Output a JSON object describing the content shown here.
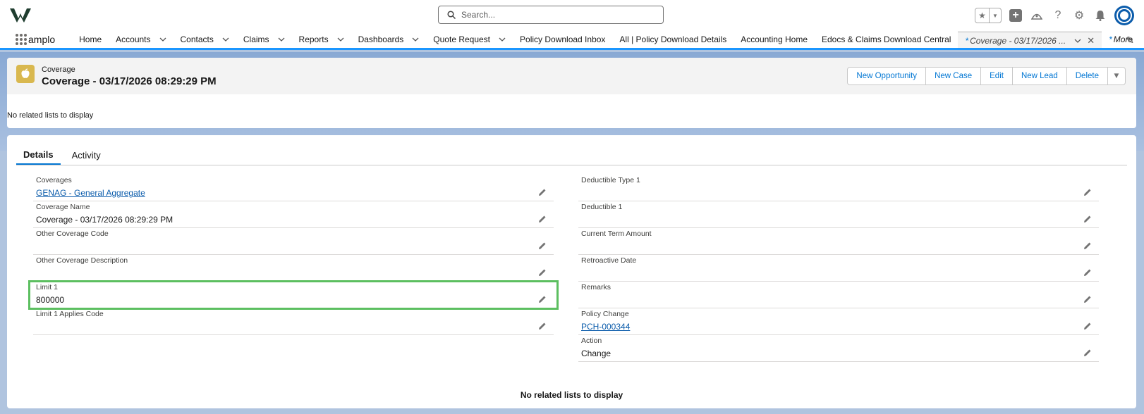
{
  "header": {
    "search_placeholder": "Search...",
    "icons": [
      "favorites-star-icon",
      "add-icon",
      "trailhead-icon",
      "help-icon",
      "setup-gear-icon",
      "notifications-bell-icon",
      "avatar"
    ]
  },
  "nav": {
    "app_name": "amplo",
    "items": [
      {
        "label": "Home",
        "dropdown": false
      },
      {
        "label": "Accounts",
        "dropdown": true
      },
      {
        "label": "Contacts",
        "dropdown": true
      },
      {
        "label": "Claims",
        "dropdown": true
      },
      {
        "label": "Reports",
        "dropdown": true
      },
      {
        "label": "Dashboards",
        "dropdown": true
      },
      {
        "label": "Quote Request",
        "dropdown": true
      },
      {
        "label": "Policy Download Inbox",
        "dropdown": false
      },
      {
        "label": "All | Policy Download Details",
        "dropdown": false
      },
      {
        "label": "Accounting Home",
        "dropdown": false
      },
      {
        "label": "Edocs & Claims Download Central",
        "dropdown": false
      }
    ],
    "active_tab": {
      "label": "Coverage - 03/17/2026 ...",
      "marker": "*"
    },
    "more": {
      "label": "More",
      "marker": "*"
    }
  },
  "record": {
    "object_label": "Coverage",
    "title": "Coverage - 03/17/2026 08:29:29 PM",
    "actions": [
      "New Opportunity",
      "New Case",
      "Edit",
      "New Lead",
      "Delete"
    ],
    "no_related_top": "No related lists to display"
  },
  "tabs": [
    {
      "label": "Details",
      "active": true
    },
    {
      "label": "Activity",
      "active": false
    }
  ],
  "fields_left": [
    {
      "label": "Coverages",
      "value": "GENAG - General Aggregate",
      "link": true
    },
    {
      "label": "Coverage Name",
      "value": "Coverage - 03/17/2026 08:29:29 PM",
      "link": false
    },
    {
      "label": "Other Coverage Code",
      "value": "",
      "link": false
    },
    {
      "label": "Other Coverage Description",
      "value": "",
      "link": false
    },
    {
      "label": "Limit 1",
      "value": "800000",
      "link": false,
      "highlighted": true
    },
    {
      "label": "Limit 1 Applies Code",
      "value": "",
      "link": false
    }
  ],
  "fields_right": [
    {
      "label": "Deductible Type 1",
      "value": "",
      "link": false
    },
    {
      "label": "Deductible 1",
      "value": "",
      "link": false
    },
    {
      "label": "Current Term Amount",
      "value": "",
      "link": false
    },
    {
      "label": "Retroactive Date",
      "value": "",
      "link": false
    },
    {
      "label": "Remarks",
      "value": "",
      "link": false
    },
    {
      "label": "Policy Change",
      "value": "PCH-000344",
      "link": true
    },
    {
      "label": "Action",
      "value": "Change",
      "link": false
    }
  ],
  "no_related_bottom": "No related lists to display",
  "colors": {
    "brand": "#0176d3",
    "highlight": "#5cbf60",
    "object_icon": "#d9b84f"
  }
}
